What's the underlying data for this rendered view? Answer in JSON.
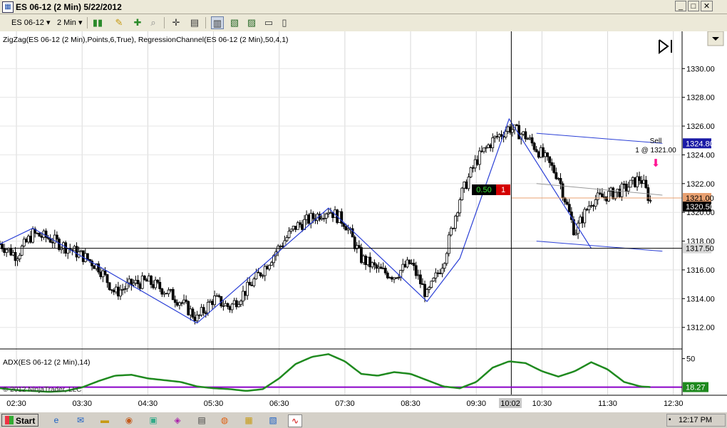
{
  "window": {
    "title": "ES 06-12 (2 Min)  5/22/2012",
    "app_icon": "chart-window-icon",
    "minimize": "_",
    "maximize": "□",
    "close": "✕"
  },
  "toolbar": {
    "instrument": "ES 06-12",
    "interval": "2 Min",
    "icons": [
      "bars-type-icon",
      "pencil-icon",
      "add-icon",
      "magnifier-icon",
      "crosshair-icon",
      "data-box-icon",
      "chart-trader-icon",
      "strategies-icon",
      "indicators-icon",
      "properties-icon"
    ]
  },
  "chart": {
    "indicators_label": "ZigZag(ES 06-12 (2 Min),Points,6,True), RegressionChannel(ES 06-12 (2 Min),50,4,1)",
    "adx_label": "ADX(ES 06-12 (2 Min),14)",
    "copyright": "© 2012 NinjaTrader, LLC",
    "adx_tick": "50",
    "adx_value": "18.27",
    "crosshair_time": "10:02",
    "sell_label": "Sell",
    "sell_detail": "1 @ 1321.00",
    "position_qty": "0.50",
    "position_size": "1",
    "tags": {
      "high": "1324.80",
      "order": "1321.00",
      "last": "1320.50",
      "crosshair": "1317.50"
    },
    "colors": {
      "up_bar": "#ffffff",
      "down_bar": "#000000",
      "zigzag": "#2a3fd6",
      "regression": "#2a3fd6",
      "adx": "#1f8a1f",
      "adx_threshold": "#8a00c8",
      "order_line": "#e8a070",
      "price_tag": "#1a1aa6"
    }
  },
  "chart_data": {
    "type": "line",
    "series": [
      {
        "name": "ES 06-12 (2 Min)",
        "x": [
          "02:15",
          "02:30",
          "02:45",
          "03:00",
          "03:15",
          "03:30",
          "03:45",
          "04:00",
          "04:15",
          "04:30",
          "04:45",
          "05:00",
          "05:15",
          "05:30",
          "05:45",
          "06:00",
          "06:15",
          "06:30",
          "06:45",
          "07:00",
          "07:15",
          "07:30",
          "07:45",
          "08:00",
          "08:15",
          "08:30",
          "08:45",
          "09:00",
          "09:15",
          "09:30",
          "09:45",
          "10:00",
          "10:15",
          "10:30",
          "10:45",
          "11:00",
          "11:15",
          "11:30",
          "11:45",
          "12:00",
          "12:10"
        ],
        "values": [
          1317.8,
          1317.0,
          1318.5,
          1318.2,
          1317.6,
          1317.0,
          1316.2,
          1314.4,
          1315.0,
          1315.2,
          1314.6,
          1313.8,
          1312.6,
          1314.0,
          1313.4,
          1314.6,
          1316.0,
          1317.6,
          1319.0,
          1319.6,
          1320.2,
          1319.3,
          1316.8,
          1316.0,
          1315.6,
          1316.5,
          1314.2,
          1316.6,
          1321.0,
          1323.6,
          1325.0,
          1325.9,
          1325.3,
          1324.0,
          1322.5,
          1318.6,
          1320.8,
          1321.2,
          1321.6,
          1322.4,
          1320.6
        ]
      },
      {
        "name": "ADX(ES 06-12 (2 Min),14)",
        "x": [
          "02:15",
          "02:30",
          "02:45",
          "03:00",
          "03:15",
          "03:30",
          "03:45",
          "04:00",
          "04:15",
          "04:30",
          "04:45",
          "05:00",
          "05:15",
          "05:30",
          "05:45",
          "06:00",
          "06:15",
          "06:30",
          "06:45",
          "07:00",
          "07:15",
          "07:30",
          "07:45",
          "08:00",
          "08:15",
          "08:30",
          "08:45",
          "09:00",
          "09:15",
          "09:30",
          "09:45",
          "10:00",
          "10:15",
          "10:30",
          "10:45",
          "11:00",
          "11:15",
          "11:30",
          "11:45",
          "12:00",
          "12:10"
        ],
        "values": [
          17,
          15,
          14,
          13,
          14,
          18,
          25,
          31,
          32,
          28,
          26,
          24,
          19,
          17,
          16,
          14,
          16,
          28,
          44,
          52,
          55,
          47,
          33,
          31,
          35,
          33,
          26,
          19,
          17,
          24,
          40,
          47,
          45,
          36,
          30,
          36,
          46,
          38,
          24,
          19,
          18.27
        ]
      }
    ],
    "x_ticks": [
      "02:30",
      "03:30",
      "04:30",
      "05:30",
      "06:30",
      "07:30",
      "08:30",
      "09:30",
      "10:30",
      "11:30",
      "12:30"
    ],
    "y_ticks": [
      "1312.00",
      "1314.00",
      "1316.00",
      "1318.00",
      "1320.00",
      "1322.00",
      "1324.00",
      "1326.00",
      "1328.00",
      "1330.00"
    ],
    "ylim": [
      1310.5,
      1331.5
    ],
    "adx_ylim": [
      10,
      60
    ],
    "adx_threshold": 18.27,
    "zigzag": [
      {
        "x": "02:15",
        "y": 1317.8
      },
      {
        "x": "02:45",
        "y": 1318.9
      },
      {
        "x": "05:15",
        "y": 1312.3
      },
      {
        "x": "07:15",
        "y": 1320.3
      },
      {
        "x": "08:45",
        "y": 1313.8
      },
      {
        "x": "09:15",
        "y": 1316.8
      },
      {
        "x": "10:00",
        "y": 1326.5
      },
      {
        "x": "11:15",
        "y": 1317.5
      }
    ],
    "grid": true
  },
  "taskbar": {
    "start_label": "Start",
    "clock": "12:17 PM",
    "icons": [
      "ie-icon",
      "outlook-icon",
      "folder-icon",
      "media-icon",
      "paint-icon",
      "firefox-icon",
      "explorer-icon",
      "notepad-icon",
      "doc-icon",
      "ninjatrader-icon"
    ]
  }
}
